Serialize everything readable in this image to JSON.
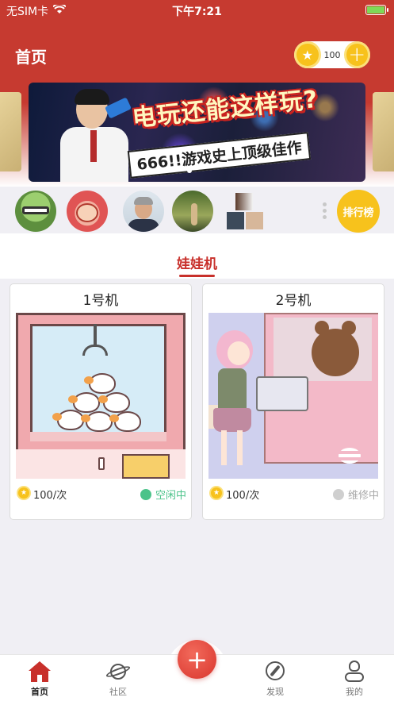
{
  "status_bar": {
    "carrier": "无SIM卡",
    "time": "下午7:21"
  },
  "header": {
    "title": "首页",
    "coins": "100"
  },
  "banner": {
    "title": "电玩还能这样玩?",
    "subtitle": "666!!游戏史上顶级佳作"
  },
  "ranking_button": "排行榜",
  "tab": {
    "label": "娃娃机"
  },
  "machines": [
    {
      "name": "1号机",
      "price": "100/次",
      "status": "空闲中",
      "status_color": "#4cc38a"
    },
    {
      "name": "2号机",
      "price": "100/次",
      "status": "维修中",
      "status_color": "#cfcfcf"
    }
  ],
  "tabbar": {
    "items": [
      {
        "label": "首页",
        "icon": "home-icon"
      },
      {
        "label": "社区",
        "icon": "planet-icon"
      },
      {
        "label": "",
        "icon": "plus-icon"
      },
      {
        "label": "发现",
        "icon": "compass-icon"
      },
      {
        "label": "我的",
        "icon": "user-icon"
      }
    ]
  },
  "colors": {
    "brand_red": "#c8302b",
    "coin_yellow": "#f7c21c",
    "idle_green": "#4cc38a",
    "repair_gray": "#cfcfcf"
  }
}
